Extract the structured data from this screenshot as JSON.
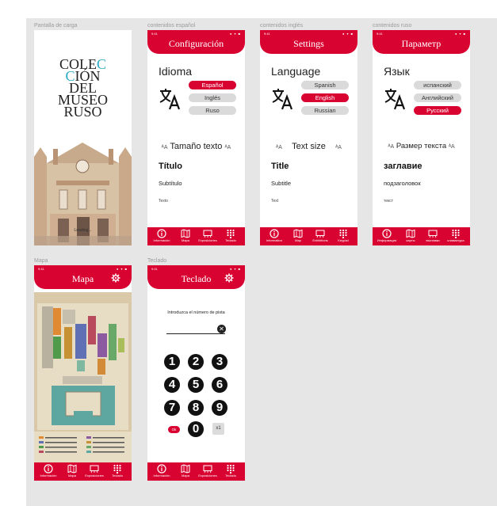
{
  "frames": {
    "loading_label": "Pantalla de carga",
    "spanish_label": "contenidos español",
    "english_label": "contenidos inglés",
    "russian_label": "contenidos ruso",
    "map_label": "Mapa",
    "keypad_label": "Teclado"
  },
  "status": {
    "time": "9:41",
    "dots": "● ▾ ■"
  },
  "loading": {
    "title_line1_a": "COLE",
    "title_line1_b": "C",
    "title_line2_a": "C",
    "title_line2_b": "IÓN",
    "title_line3": "DEL",
    "title_line4": "MUSEO",
    "title_line5": "RUSO",
    "loading_text": "Loading..."
  },
  "es": {
    "header": "Configuración",
    "language_title": "Idioma",
    "options": [
      "Español",
      "Inglés",
      "Ruso"
    ],
    "selected_index": 0,
    "text_size": "Tamaño texto",
    "sample_title": "Título",
    "sample_subtitle": "Subtítulo",
    "sample_text": "Texto",
    "nav": [
      "Información",
      "Mapa",
      "Exposiciones",
      "Teclado"
    ]
  },
  "en": {
    "header": "Settings",
    "language_title": "Language",
    "options": [
      "Spanish",
      "English",
      "Russian"
    ],
    "selected_index": 1,
    "text_size": "Text size",
    "sample_title": "Title",
    "sample_subtitle": "Subtitle",
    "sample_text": "Text",
    "nav": [
      "Information",
      "Map",
      "Exhibitions",
      "Keypad"
    ]
  },
  "ru": {
    "header": "Параметр",
    "language_title": "Язык",
    "options": [
      "испанский",
      "Английский",
      "Русский"
    ],
    "selected_index": 2,
    "text_size": "Размер текста",
    "sample_title": "заглавие",
    "sample_subtitle": "подзаголовок",
    "sample_text": "текст",
    "nav": [
      "Информация",
      "карты",
      "выставки",
      "клавиатура"
    ]
  },
  "map": {
    "header": "Mapa",
    "nav": [
      "Información",
      "Mapa",
      "Exposiciones",
      "Teclado"
    ]
  },
  "keypad": {
    "header": "Teclado",
    "prompt": "Introduzca el número de pista",
    "clear": "✕",
    "keys": [
      "1",
      "2",
      "3",
      "4",
      "5",
      "6",
      "7",
      "8",
      "9",
      "0"
    ],
    "ok": "Ok",
    "x1": "x1",
    "nav": [
      "Información",
      "Mapa",
      "Exposiciones",
      "Teclado"
    ]
  },
  "colors": {
    "accent": "#d90332",
    "canvas": "#e6e6e6",
    "teal": "#2aa9c4"
  },
  "icons": [
    "translate-icon",
    "info-icon",
    "map-icon",
    "exhibitions-icon",
    "keypad-icon",
    "gear-icon",
    "text-size-icon",
    "clear-icon"
  ]
}
